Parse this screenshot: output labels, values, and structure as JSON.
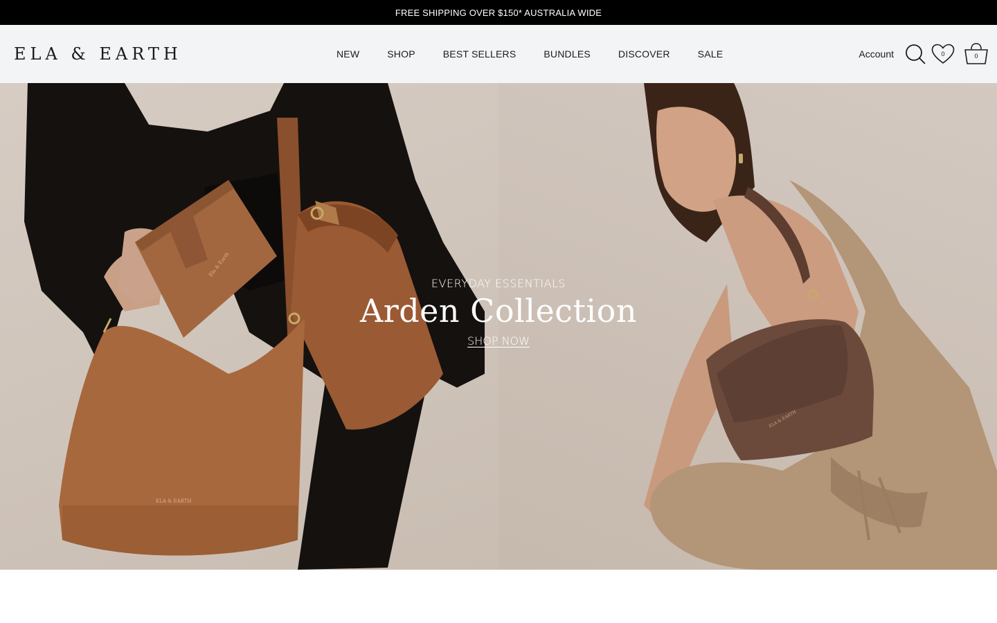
{
  "announcement": {
    "text": "FREE SHIPPING OVER $150* AUSTRALIA WIDE"
  },
  "header": {
    "logo": "ELA & EARTH",
    "nav": [
      {
        "label": "NEW"
      },
      {
        "label": "SHOP"
      },
      {
        "label": "BEST SELLERS"
      },
      {
        "label": "BUNDLES"
      },
      {
        "label": "DISCOVER"
      },
      {
        "label": "SALE"
      }
    ],
    "account_label": "Account",
    "wishlist_count": "0",
    "cart_count": "0",
    "icons": [
      "search-icon",
      "heart-icon",
      "cart-icon"
    ]
  },
  "hero": {
    "eyebrow": "EVERYDAY ESSENTIALS",
    "title": "Arden Collection",
    "cta": "SHOP NOW",
    "left_image": "woman-in-black-blazer-holding-tan-leather-wallet-and-bags",
    "right_image": "woman-in-knit-dress-with-brown-shoulder-bag",
    "bag_brand_mark": "ELA & EARTH"
  },
  "colors": {
    "announcement_bg": "#000000",
    "header_bg": "#f3f4f6",
    "text": "#1a1a1a",
    "hero_text": "#ffffff",
    "tan_leather": "#a8683d",
    "brown_leather": "#6b4a3c"
  }
}
